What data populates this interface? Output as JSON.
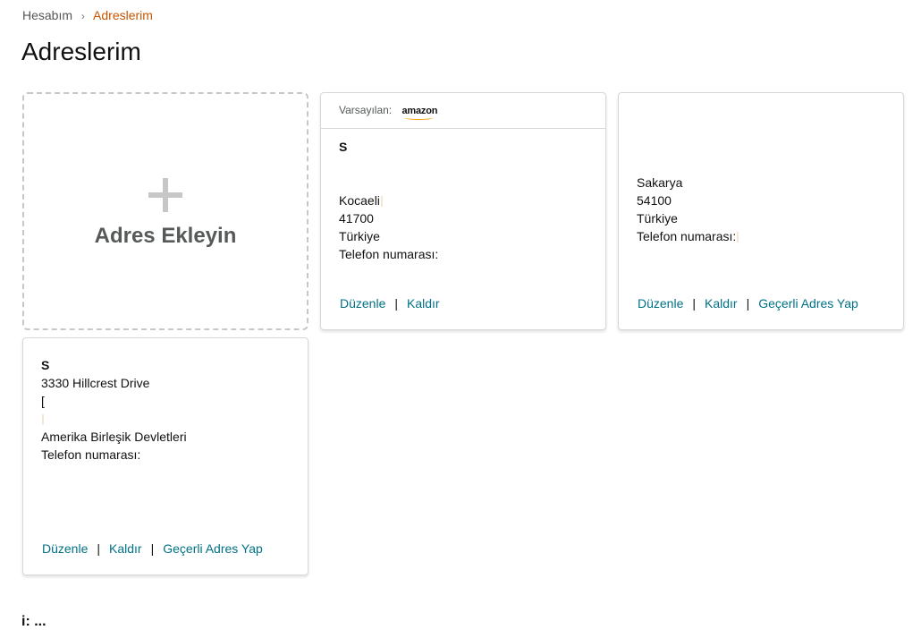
{
  "breadcrumb": {
    "parent": "Hesabım",
    "separator": "›",
    "current": "Adreslerim"
  },
  "page_title": "Adreslerim",
  "add_card": {
    "label": "Adres Ekleyin"
  },
  "cards": [
    {
      "header": {
        "default_label": "Varsayılan:",
        "logo_text": "amazon"
      },
      "name": "S",
      "lines": [
        "",
        "",
        "Kocaeli",
        "41700",
        "Türkiye",
        "Telefon numarası:"
      ],
      "actions": [
        "Düzenle",
        "Kaldır"
      ]
    },
    {
      "name": "",
      "lines": [
        "",
        "",
        "Sakarya",
        "54100",
        "Türkiye",
        "Telefon numarası:"
      ],
      "actions": [
        "Düzenle",
        "Kaldır",
        "Geçerli Adres Yap"
      ]
    },
    {
      "name": "S",
      "lines": [
        "3330 Hillcrest Drive",
        "[",
        "",
        "Amerika Birleşik Devletleri",
        "Telefon numarası:"
      ],
      "actions": [
        "Düzenle",
        "Kaldır",
        "Geçerli Adres Yap"
      ]
    }
  ],
  "footer_fragment": "i: ..."
}
